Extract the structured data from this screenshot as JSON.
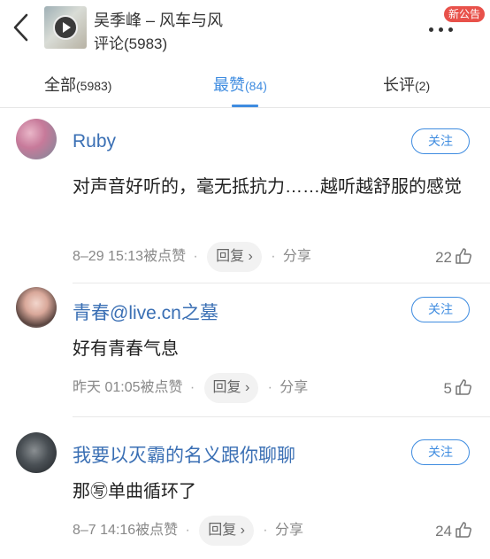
{
  "header": {
    "song_title": "吴季峰 – 风车与风",
    "comment_count": "评论(5983)",
    "new_badge": "新公告",
    "back_icon": "chevron-left-icon",
    "more_icon": "more-dots-icon"
  },
  "tabs": [
    {
      "label": "全部",
      "count": "(5983)",
      "active": false
    },
    {
      "label": "最赞",
      "count": "(84)",
      "active": true
    },
    {
      "label": "长评",
      "count": "(2)",
      "active": false
    }
  ],
  "colors": {
    "accent": "#3f8ce0",
    "username": "#3a6fb4",
    "badge": "#e8514a"
  },
  "comments": [
    {
      "username": "Ruby",
      "follow_label": "关注",
      "text": "对声音好听的，毫无抵抗力……越听越舒服的感觉",
      "time": "8–29 15:13被点赞",
      "reply_label": "回复 ›",
      "share_label": "分享",
      "likes": "22"
    },
    {
      "username": "青春@live.cn之墓",
      "follow_label": "关注",
      "text": "好有青春气息",
      "time": "昨天 01:05被点赞",
      "reply_label": "回复 ›",
      "share_label": "分享",
      "likes": "5"
    },
    {
      "username": "我要以灭霸的名义跟你聊聊",
      "follow_label": "关注",
      "text": "那㊢单曲循环了",
      "time": "8–7 14:16被点赞",
      "reply_label": "回复 ›",
      "share_label": "分享",
      "likes": "24"
    }
  ]
}
